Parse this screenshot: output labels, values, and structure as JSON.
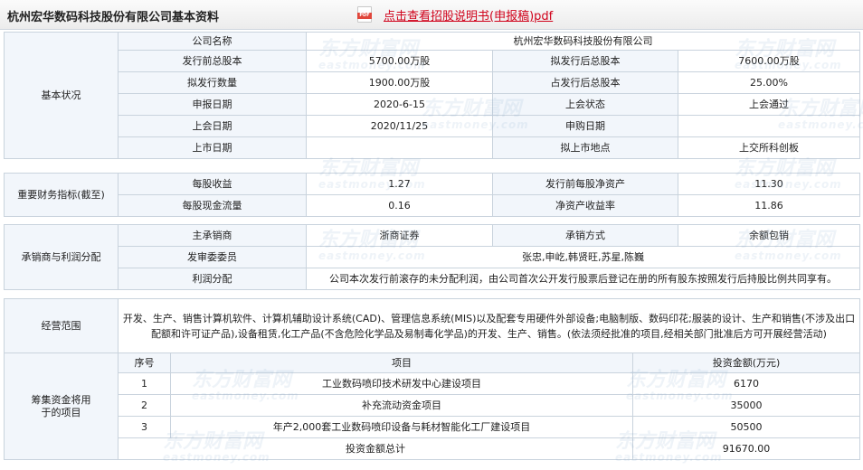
{
  "header": {
    "title": "杭州宏华数码科技股份有限公司基本资料",
    "pdf_link": "点击查看招股说明书(申报稿)pdf",
    "pdf_icon_text": "PDF"
  },
  "basic": {
    "section": "基本状况",
    "company_name_label": "公司名称",
    "company_name": "杭州宏华数码科技股份有限公司",
    "pre_total_shares_label": "发行前总股本",
    "pre_total_shares": "5700.00万股",
    "post_total_shares_label": "拟发行后总股本",
    "post_total_shares": "7600.00万股",
    "issue_qty_label": "拟发行数量",
    "issue_qty": "1900.00万股",
    "issue_ratio_label": "占发行后总股本",
    "issue_ratio": "25.00%",
    "apply_date_label": "申报日期",
    "apply_date": "2020-6-15",
    "meeting_status_label": "上会状态",
    "meeting_status": "上会通过",
    "meeting_date_label": "上会日期",
    "meeting_date": "2020/11/25",
    "subscribe_date_label": "申购日期",
    "subscribe_date": "",
    "listing_date_label": "上市日期",
    "listing_date": "",
    "listing_place_label": "拟上市地点",
    "listing_place": "上交所科创板"
  },
  "finance": {
    "section": "重要财务指标(截至)",
    "eps_label": "每股收益",
    "eps": "1.27",
    "nav_label": "发行前每股净资产",
    "nav": "11.30",
    "cfps_label": "每股现金流量",
    "cfps": "0.16",
    "roe_label": "净资产收益率",
    "roe": "11.86"
  },
  "underwriting": {
    "section": "承销商与利润分配",
    "lead_label": "主承销商",
    "lead": "浙商证券",
    "method_label": "承销方式",
    "method": "余额包销",
    "committee_label": "发审委委员",
    "committee": "张忠,申屹,韩贤旺,苏星,陈巍",
    "profit_label": "利润分配",
    "profit": "公司本次发行前滚存的未分配利润，由公司首次公开发行股票后登记在册的所有股东按照发行后持股比例共同享有。"
  },
  "scope": {
    "section": "经营范围",
    "text": "开发、生产、销售计算机软件、计算机辅助设计系统(CAD)、管理信息系统(MIS)以及配套专用硬件外部设备;电脑制版、数码印花;服装的设计、生产和销售(不涉及出口配额和许可证产品),设备租赁,化工产品(不含危险化学品及易制毒化学品)的开发、生产、销售。(依法须经批准的项目,经相关部门批准后方可开展经营活动)"
  },
  "projects": {
    "section": "筹集资金将用于的项目",
    "col_no": "序号",
    "col_name": "项目",
    "col_amount": "投资金额(万元)",
    "rows": [
      {
        "no": "1",
        "name": "工业数码喷印技术研发中心建设项目",
        "amount": "6170"
      },
      {
        "no": "2",
        "name": "补充流动资金项目",
        "amount": "35000"
      },
      {
        "no": "3",
        "name": "年产2,000套工业数码喷印设备与耗材智能化工厂建设项目",
        "amount": "50500"
      }
    ],
    "total_label": "投资金额总计",
    "total": "91670.00"
  },
  "watermark": {
    "cn": "东方财富网",
    "en": "eastmoney.com"
  }
}
